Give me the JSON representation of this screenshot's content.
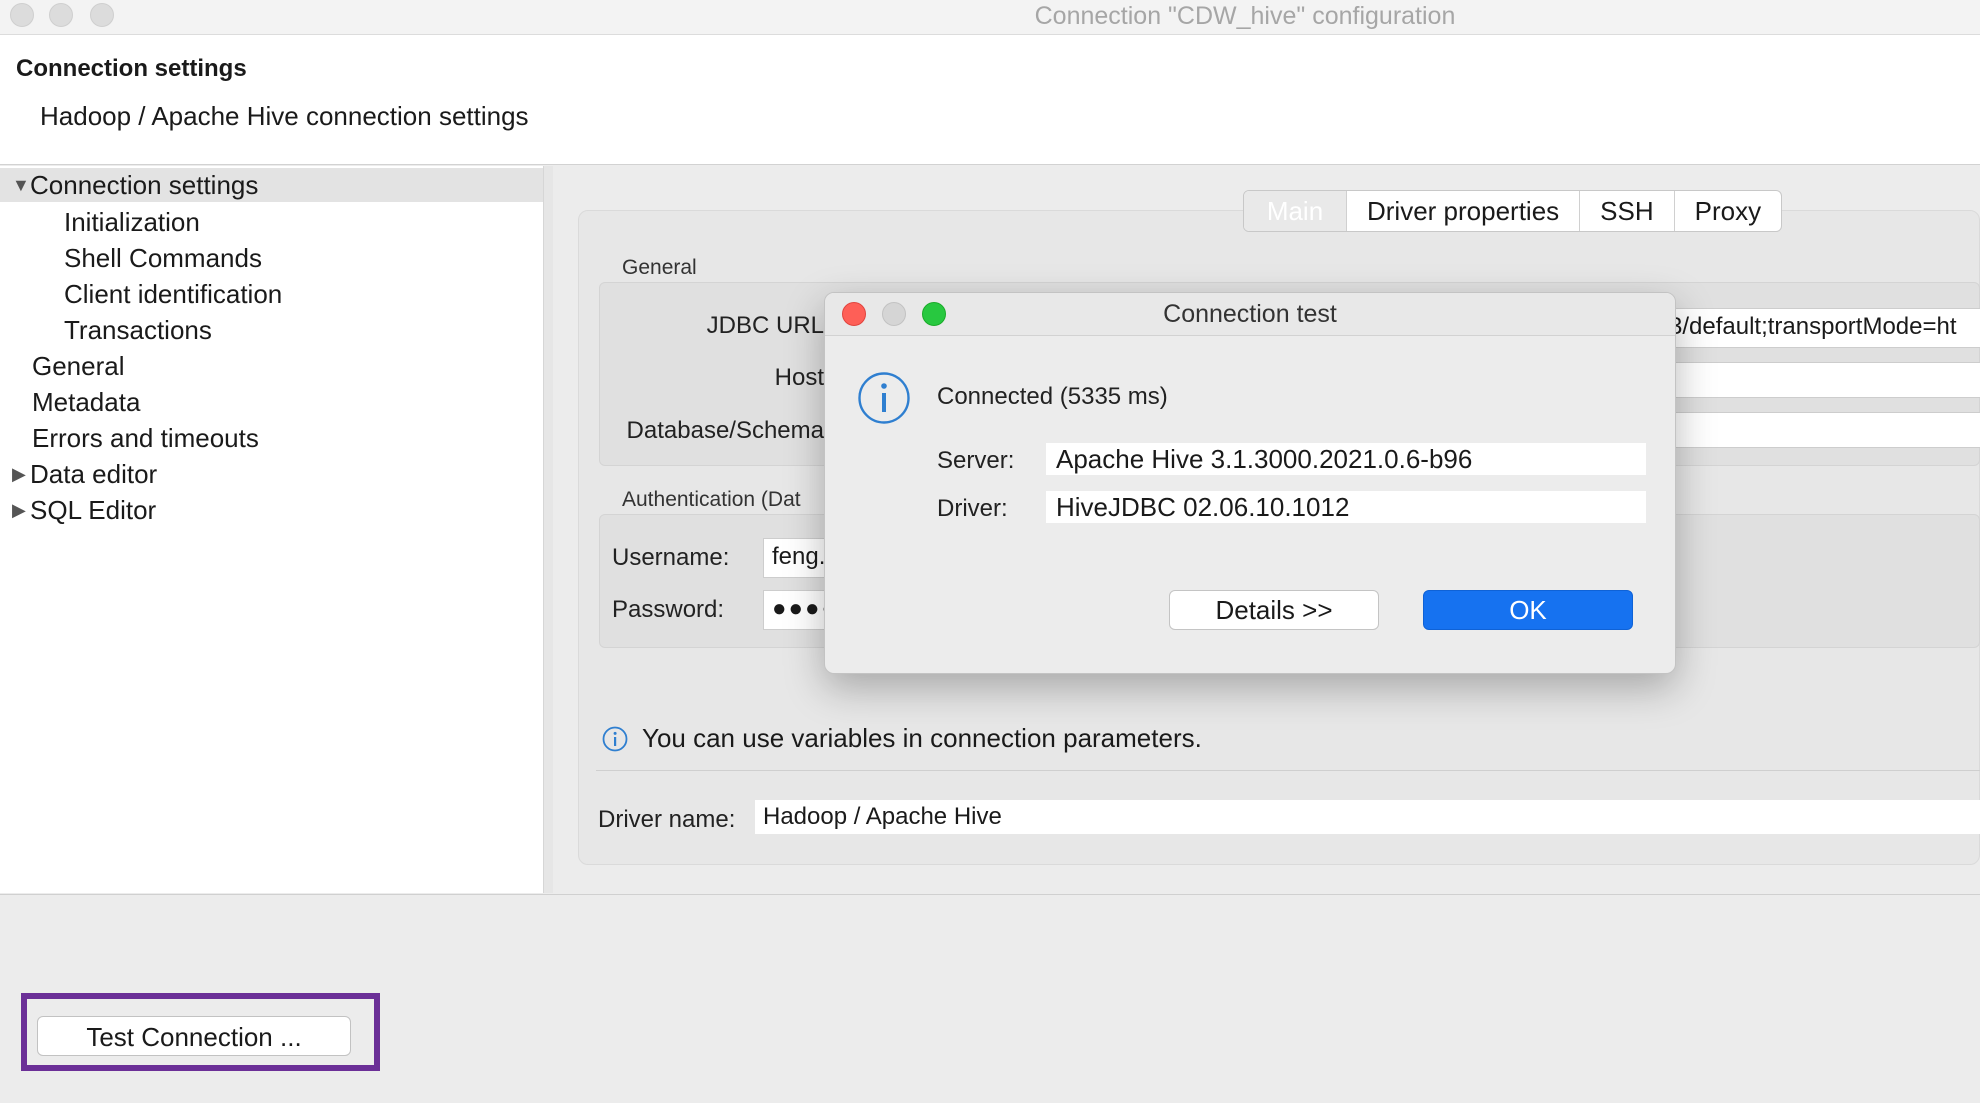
{
  "window": {
    "title": "Connection \"CDW_hive\" configuration"
  },
  "header": {
    "title": "Connection settings",
    "subtitle": "Hadoop / Apache Hive connection settings"
  },
  "tree": {
    "items": [
      {
        "label": "Connection settings",
        "expanded": true,
        "selected": true
      },
      {
        "label": "Initialization"
      },
      {
        "label": "Shell Commands"
      },
      {
        "label": "Client identification"
      },
      {
        "label": "Transactions"
      },
      {
        "label": "General"
      },
      {
        "label": "Metadata"
      },
      {
        "label": "Errors and timeouts"
      },
      {
        "label": "Data editor",
        "expanded": false
      },
      {
        "label": "SQL Editor",
        "expanded": false
      }
    ]
  },
  "tabs": [
    {
      "label": "Main",
      "active": true
    },
    {
      "label": "Driver properties"
    },
    {
      "label": "SSH"
    },
    {
      "label": "Proxy"
    }
  ],
  "general": {
    "label": "General",
    "jdbc_url_label": "JDBC URL",
    "jdbc_url_value": "3/default;transportMode=ht",
    "host_label": "Host",
    "database_label": "Database/Schema"
  },
  "auth": {
    "label": "Authentication (Dat",
    "username_label": "Username:",
    "username_value": "feng.",
    "password_label": "Password:",
    "password_value": "●●●●"
  },
  "variables_note": "You can use variables in connection parameters.",
  "driver": {
    "label": "Driver name:",
    "value": "Hadoop / Apache Hive"
  },
  "test_button": "Test Connection ...",
  "dialog": {
    "title": "Connection test",
    "status": "Connected (5335 ms)",
    "server_label": "Server:",
    "server_value": "Apache Hive 3.1.3000.2021.0.6-b96",
    "driver_label": "Driver:",
    "driver_value": "HiveJDBC 02.06.10.1012",
    "details_button": "Details >>",
    "ok_button": "OK"
  },
  "colors": {
    "accent": "#1672f0",
    "highlight": "#6b2f97",
    "info": "#2f7fd0"
  }
}
